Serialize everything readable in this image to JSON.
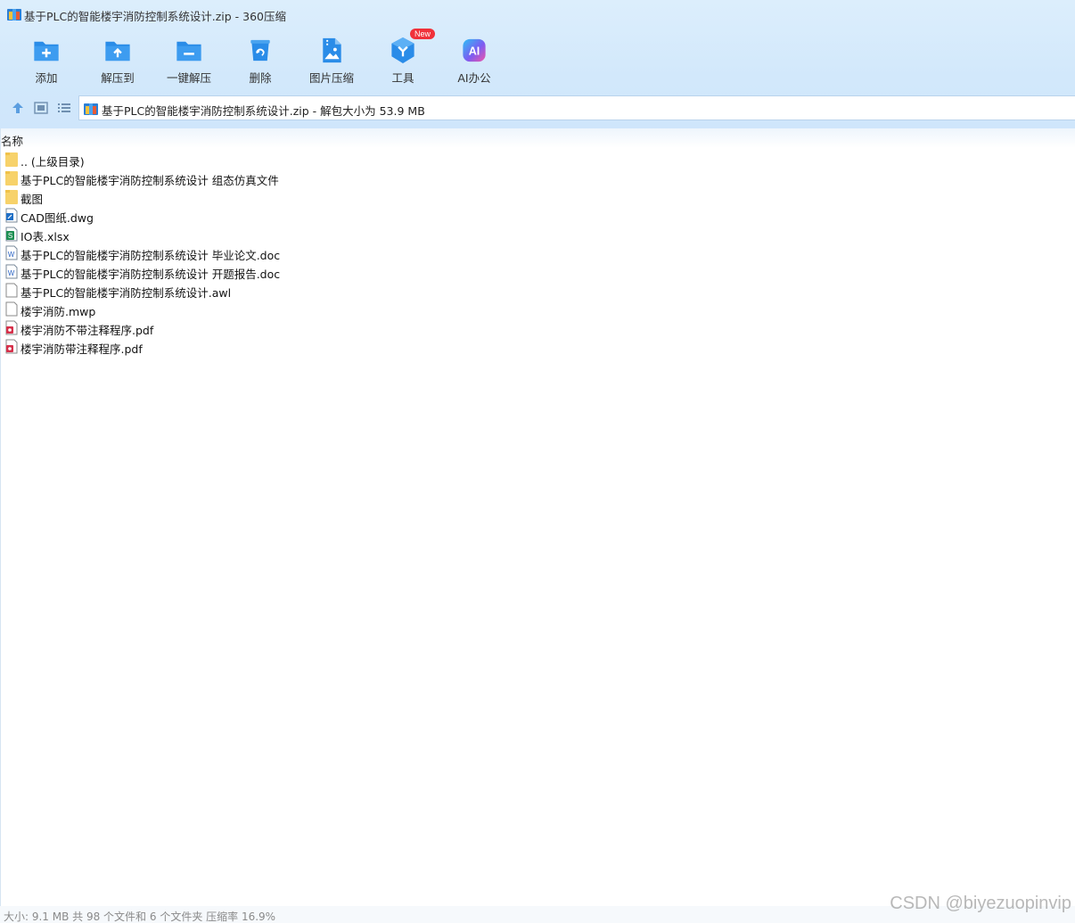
{
  "window": {
    "title": "基于PLC的智能楼宇消防控制系统设计.zip - 360压缩",
    "icon": "archive-icon"
  },
  "toolbar": {
    "add": "添加",
    "extract_to": "解压到",
    "one_click_extract": "一键解压",
    "delete": "删除",
    "image_compress": "图片压缩",
    "tools": "工具",
    "tools_badge": "New",
    "ai_office": "AI办公",
    "ai_icon_text": "AI"
  },
  "address_bar": {
    "path": "基于PLC的智能楼宇消防控制系统设计.zip - 解包大小为 53.9 MB"
  },
  "list": {
    "column_name": "名称",
    "items": [
      {
        "name": ".. (上级目录)",
        "type": "folder"
      },
      {
        "name": "基于PLC的智能楼宇消防控制系统设计 组态仿真文件",
        "type": "folder"
      },
      {
        "name": "截图",
        "type": "folder"
      },
      {
        "name": "CAD图纸.dwg",
        "type": "dwg"
      },
      {
        "name": "IO表.xlsx",
        "type": "xlsx"
      },
      {
        "name": "基于PLC的智能楼宇消防控制系统设计 毕业论文.doc",
        "type": "doc"
      },
      {
        "name": "基于PLC的智能楼宇消防控制系统设计 开题报告.doc",
        "type": "doc"
      },
      {
        "name": "基于PLC的智能楼宇消防控制系统设计.awl",
        "type": "generic"
      },
      {
        "name": "楼宇消防.mwp",
        "type": "generic"
      },
      {
        "name": "楼宇消防不带注释程序.pdf",
        "type": "pdf"
      },
      {
        "name": "楼宇消防带注释程序.pdf",
        "type": "pdf"
      }
    ]
  },
  "status": {
    "text": "大小: 9.1 MB 共 98 个文件和 6 个文件夹 压缩率 16.9%"
  },
  "watermark": "CSDN @biyezuopinvip",
  "colors": {
    "accent": "#2a8ce8",
    "folder": "#f7d26a",
    "badge": "#f0313a"
  }
}
